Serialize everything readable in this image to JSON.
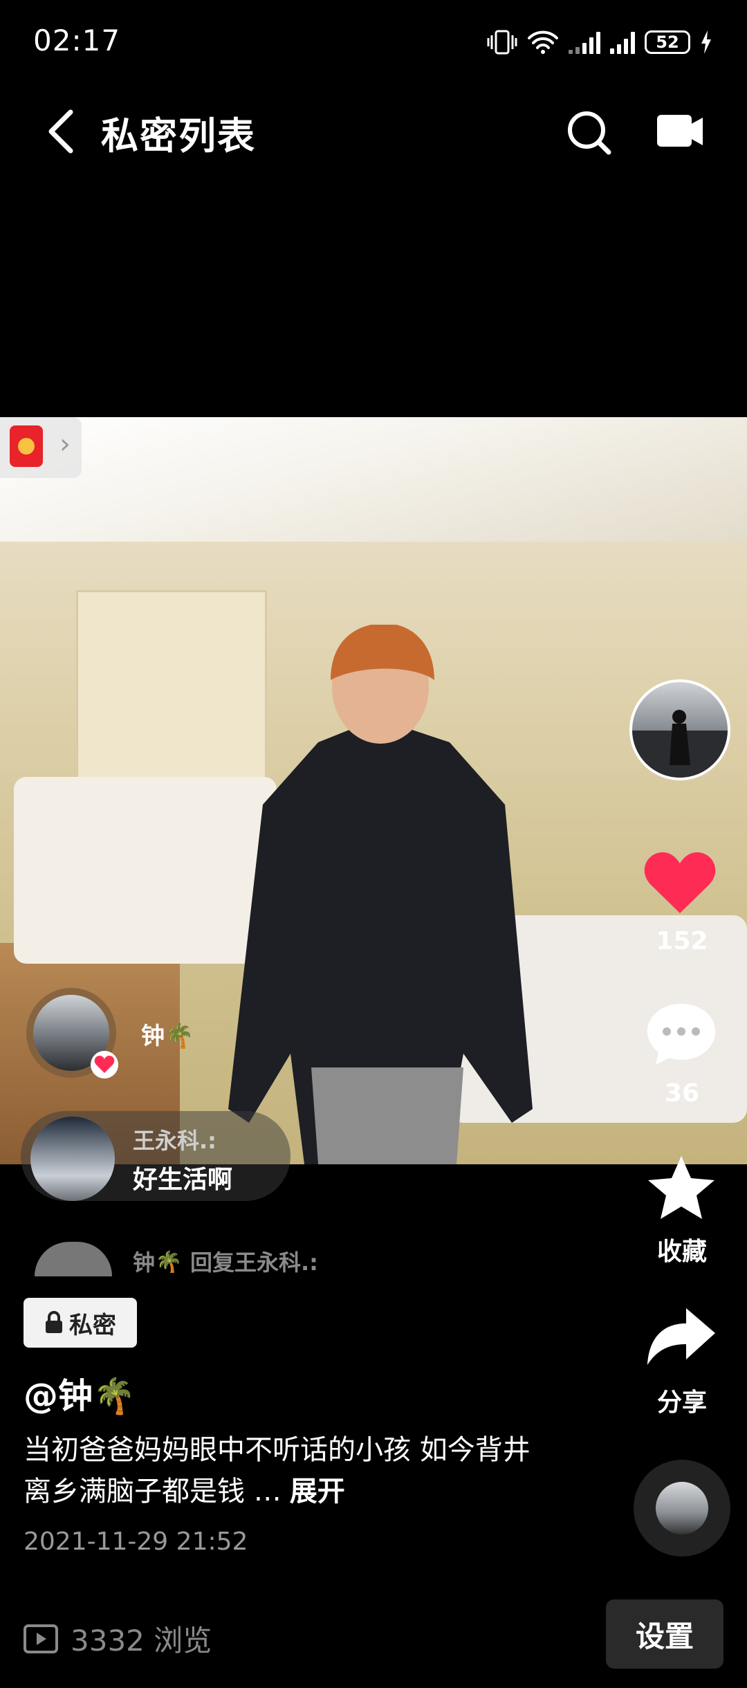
{
  "status_bar": {
    "time": "02:17",
    "battery": "52"
  },
  "header": {
    "title": "私密列表"
  },
  "video": {
    "author_handle": "@钟🌴",
    "privacy_label": "私密",
    "caption": "当初爸爸妈妈眼中不听话的小孩 如今背井离乡满脑子都是钱 …",
    "expand_label": "展开",
    "date": "2021-11-29 21:52"
  },
  "actions": {
    "like_count": "152",
    "comment_count": "36",
    "favorite_label": "收藏",
    "share_label": "分享"
  },
  "comments": [
    {
      "name": "钟🌴"
    },
    {
      "name": "王永科.:",
      "text": "好生活啊"
    },
    {
      "name": "钟🌴 回复王永科.:"
    }
  ],
  "footer": {
    "views": "3332 浏览",
    "settings_label": "设置"
  },
  "colors": {
    "like": "#fe2c55",
    "background": "#000000"
  }
}
